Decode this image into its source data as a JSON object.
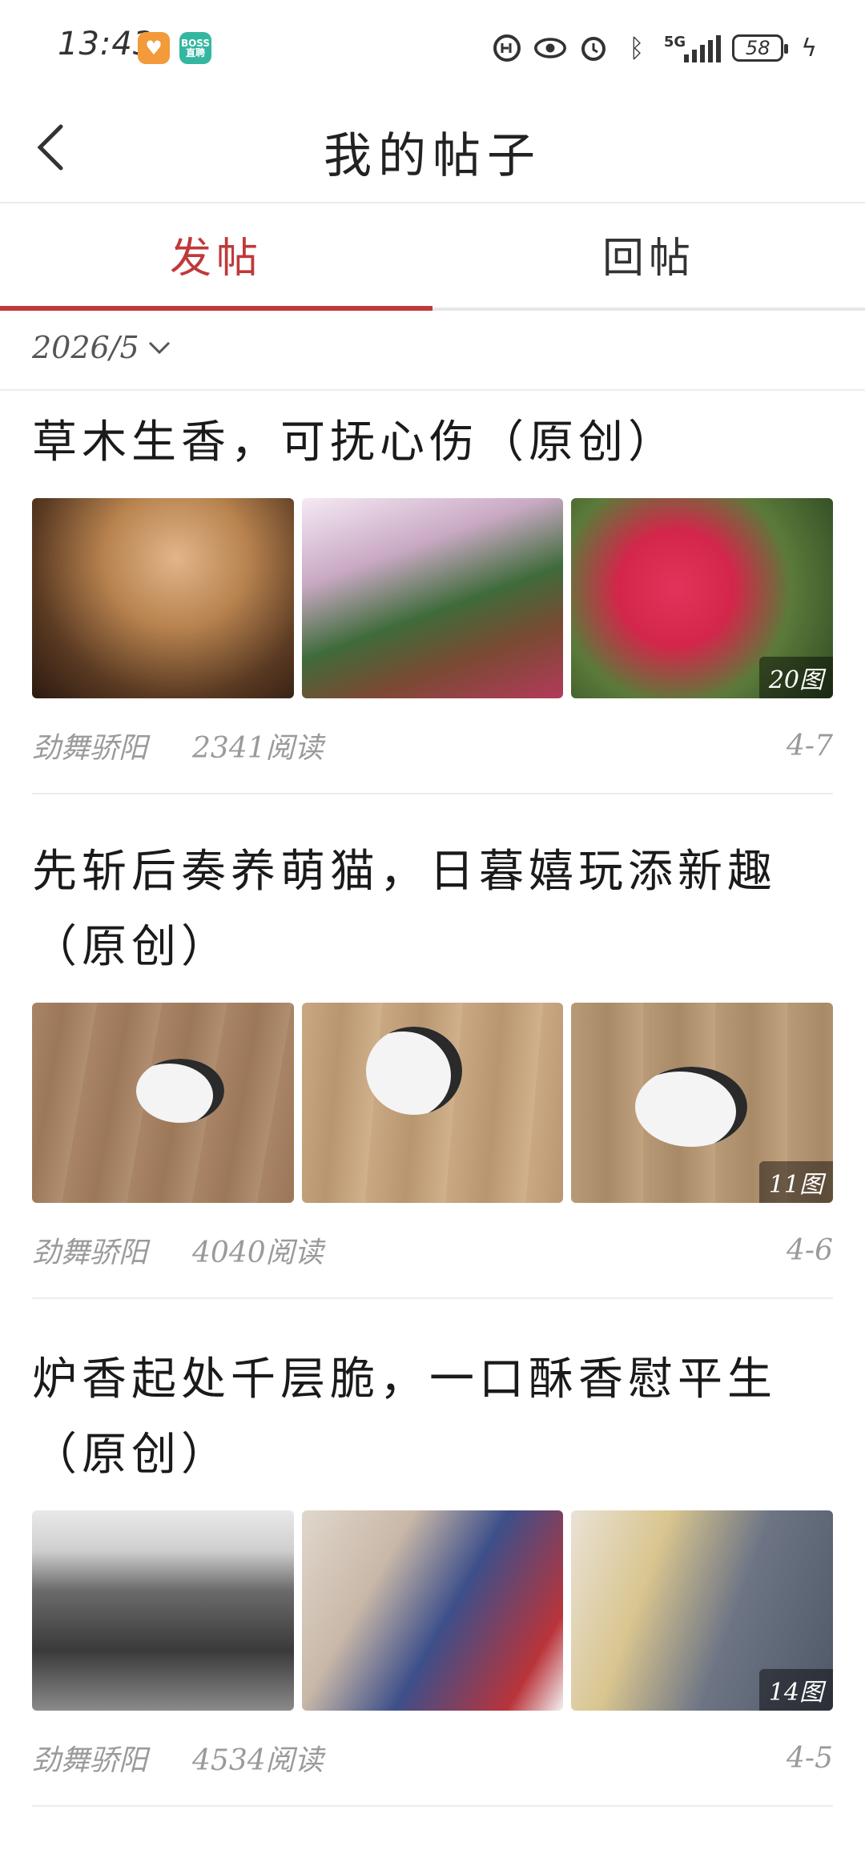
{
  "status_bar": {
    "time": "13:43",
    "badge_boss": "BOSS\n直聘",
    "network": "5G",
    "battery": "58"
  },
  "header": {
    "title": "我的帖子"
  },
  "tabs": [
    {
      "label": "发帖",
      "active": true
    },
    {
      "label": "回帖",
      "active": false
    }
  ],
  "filter": {
    "month": "2026/5"
  },
  "posts": [
    {
      "title": "草木生香，可抚心伤（原创）",
      "image_count": "20图",
      "author": "劲舞骄阳",
      "reads": "2341阅读",
      "date": "4-7"
    },
    {
      "title": "先斩后奏养萌猫，日暮嬉玩添新趣（原创）",
      "image_count": "11图",
      "author": "劲舞骄阳",
      "reads": "4040阅读",
      "date": "4-6"
    },
    {
      "title": "炉香起处千层脆，一口酥香慰平生（原创）",
      "image_count": "14图",
      "author": "劲舞骄阳",
      "reads": "4534阅读",
      "date": "4-5"
    }
  ],
  "colors": {
    "accent": "#c0393b",
    "divider": "#ededed",
    "meta_text": "#9a9a9a"
  }
}
